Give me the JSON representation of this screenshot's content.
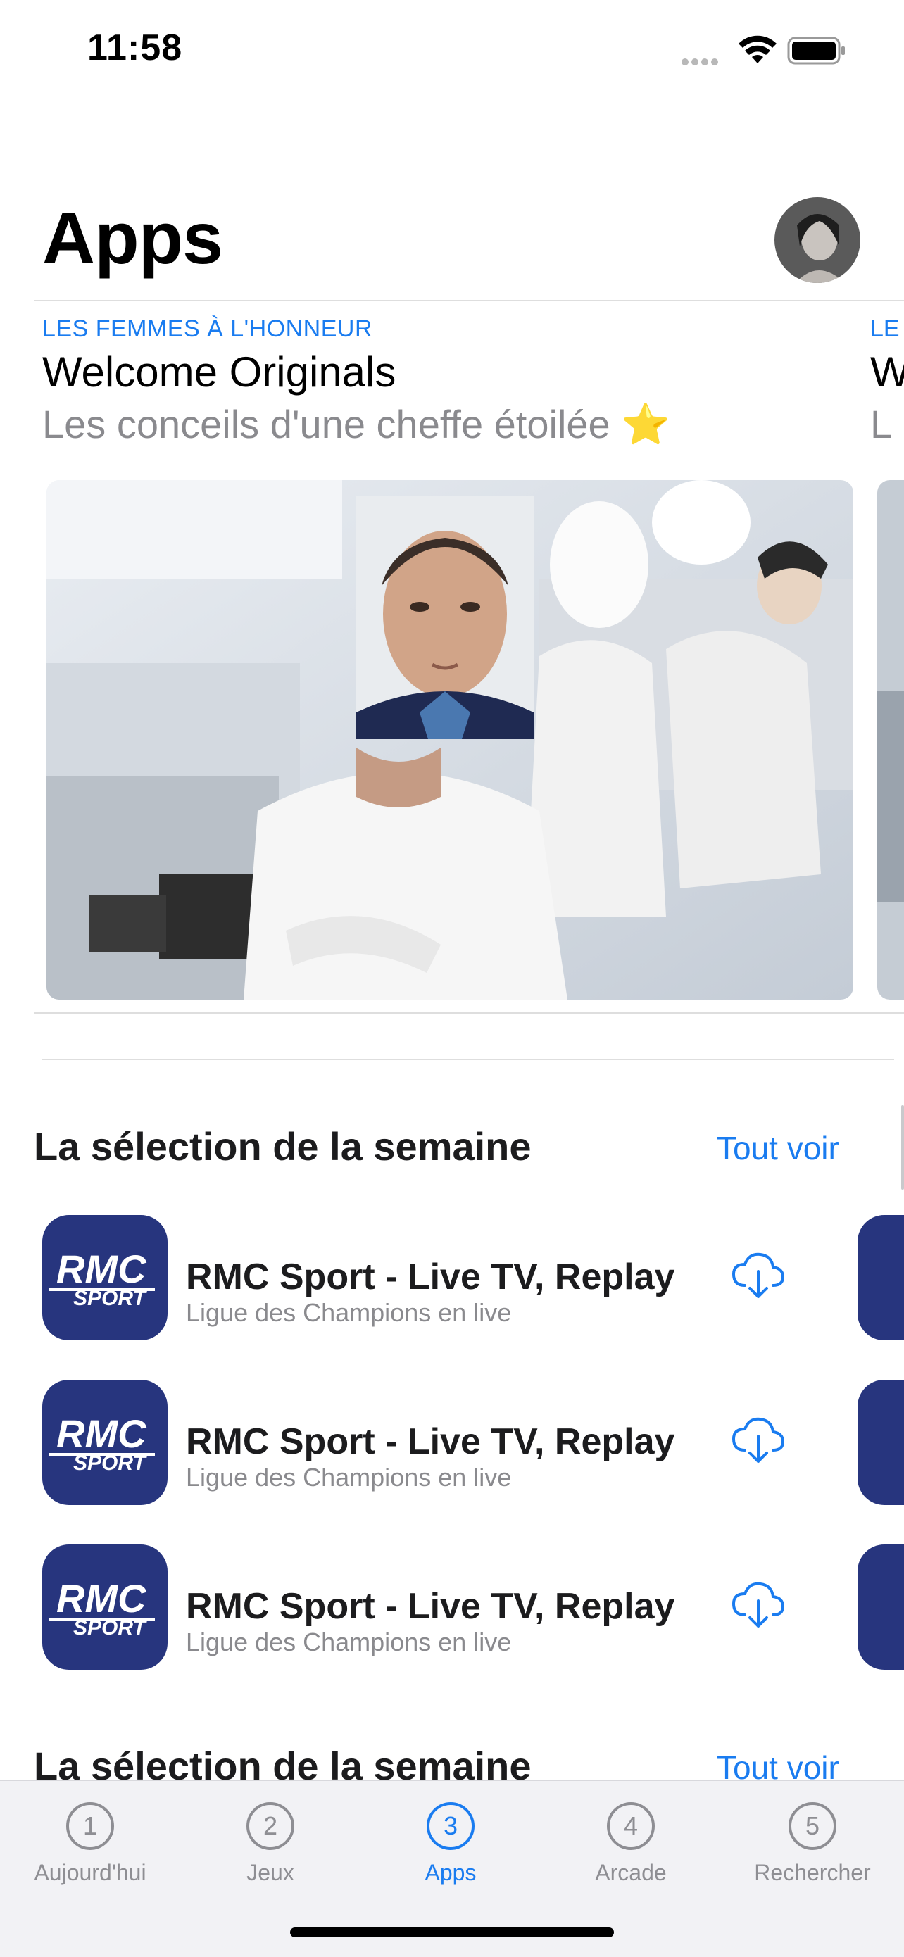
{
  "status": {
    "time": "11:58"
  },
  "header": {
    "title": "Apps"
  },
  "featured": {
    "eyebrow": "LES FEMMES À L'HONNEUR",
    "title": "Welcome Originals",
    "subtitle": "Les conceils d'une cheffe étoilée ⭐",
    "peek_eyebrow": "LE",
    "peek_title": "W",
    "peek_subtitle": "L"
  },
  "sections": [
    {
      "title": "La sélection de la semaine",
      "see_all": "Tout voir",
      "apps": [
        {
          "name": "RMC Sport - Live TV, Replay",
          "subtitle": "Ligue des Champions en live",
          "icon_text_top": "RMC",
          "icon_text_bottom": "SPORT"
        },
        {
          "name": "RMC Sport - Live TV, Replay",
          "subtitle": "Ligue des Champions en live",
          "icon_text_top": "RMC",
          "icon_text_bottom": "SPORT"
        },
        {
          "name": "RMC Sport - Live TV, Replay",
          "subtitle": "Ligue des Champions en live",
          "icon_text_top": "RMC",
          "icon_text_bottom": "SPORT"
        }
      ]
    },
    {
      "title": "La sélection de la semaine",
      "see_all": "Tout voir"
    }
  ],
  "tabs": [
    {
      "num": "1",
      "label": "Aujourd'hui"
    },
    {
      "num": "2",
      "label": "Jeux"
    },
    {
      "num": "3",
      "label": "Apps"
    },
    {
      "num": "4",
      "label": "Arcade"
    },
    {
      "num": "5",
      "label": "Rechercher"
    }
  ],
  "colors": {
    "accent": "#1a7cf0",
    "app_icon_bg": "#27357e",
    "secondary_text": "#8a8a8e"
  },
  "icons": [
    "wifi-icon",
    "battery-icon",
    "cloud-download-icon",
    "profile-avatar"
  ]
}
